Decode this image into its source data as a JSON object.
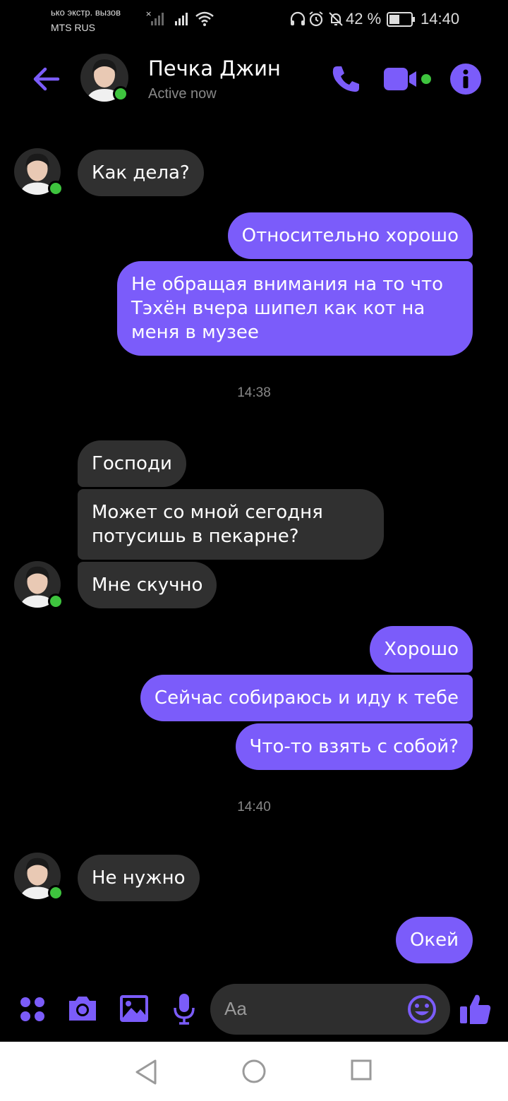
{
  "status_bar": {
    "carrier_line1": "ько экстр. вызов",
    "carrier_line2": "MTS RUS",
    "battery": "42 %",
    "time": "14:40"
  },
  "header": {
    "contact_name": "Печка Джин",
    "contact_status": "Active now"
  },
  "messages": [
    {
      "side": "in",
      "text": "Как дела?"
    },
    {
      "side": "out",
      "text": "Относительно хорошо"
    },
    {
      "side": "out",
      "lines": [
        "Не обращая внимания на то что",
        "Тэхён вчера шипел как кот на",
        "меня в музее"
      ]
    },
    {
      "type": "timestamp",
      "text": "14:38"
    },
    {
      "side": "in",
      "text": "Господи"
    },
    {
      "side": "in",
      "lines": [
        "Может со мной сегодня",
        "потусишь в пекарне?"
      ]
    },
    {
      "side": "in",
      "text": "Мне скучно"
    },
    {
      "side": "out",
      "text": "Хорошо"
    },
    {
      "side": "out",
      "text": "Сейчас собираюсь и иду к тебе"
    },
    {
      "side": "out",
      "text": "Что-то взять с собой?"
    },
    {
      "type": "timestamp",
      "text": "14:40"
    },
    {
      "side": "in",
      "text": "Не нужно"
    },
    {
      "side": "out",
      "text": "Окей"
    }
  ],
  "composer": {
    "placeholder": "Aa",
    "icons": [
      "apps-icon",
      "camera-icon",
      "gallery-icon",
      "microphone-icon",
      "emoji-icon",
      "thumbs-up-icon"
    ]
  },
  "nav_bar": {
    "icons": [
      "back-triangle-icon",
      "home-circle-icon",
      "recents-square-icon"
    ]
  },
  "colors": {
    "accent": "#7b5cfa",
    "incoming_bubble": "#303030",
    "online": "#3ec43e",
    "background": "#000000"
  }
}
